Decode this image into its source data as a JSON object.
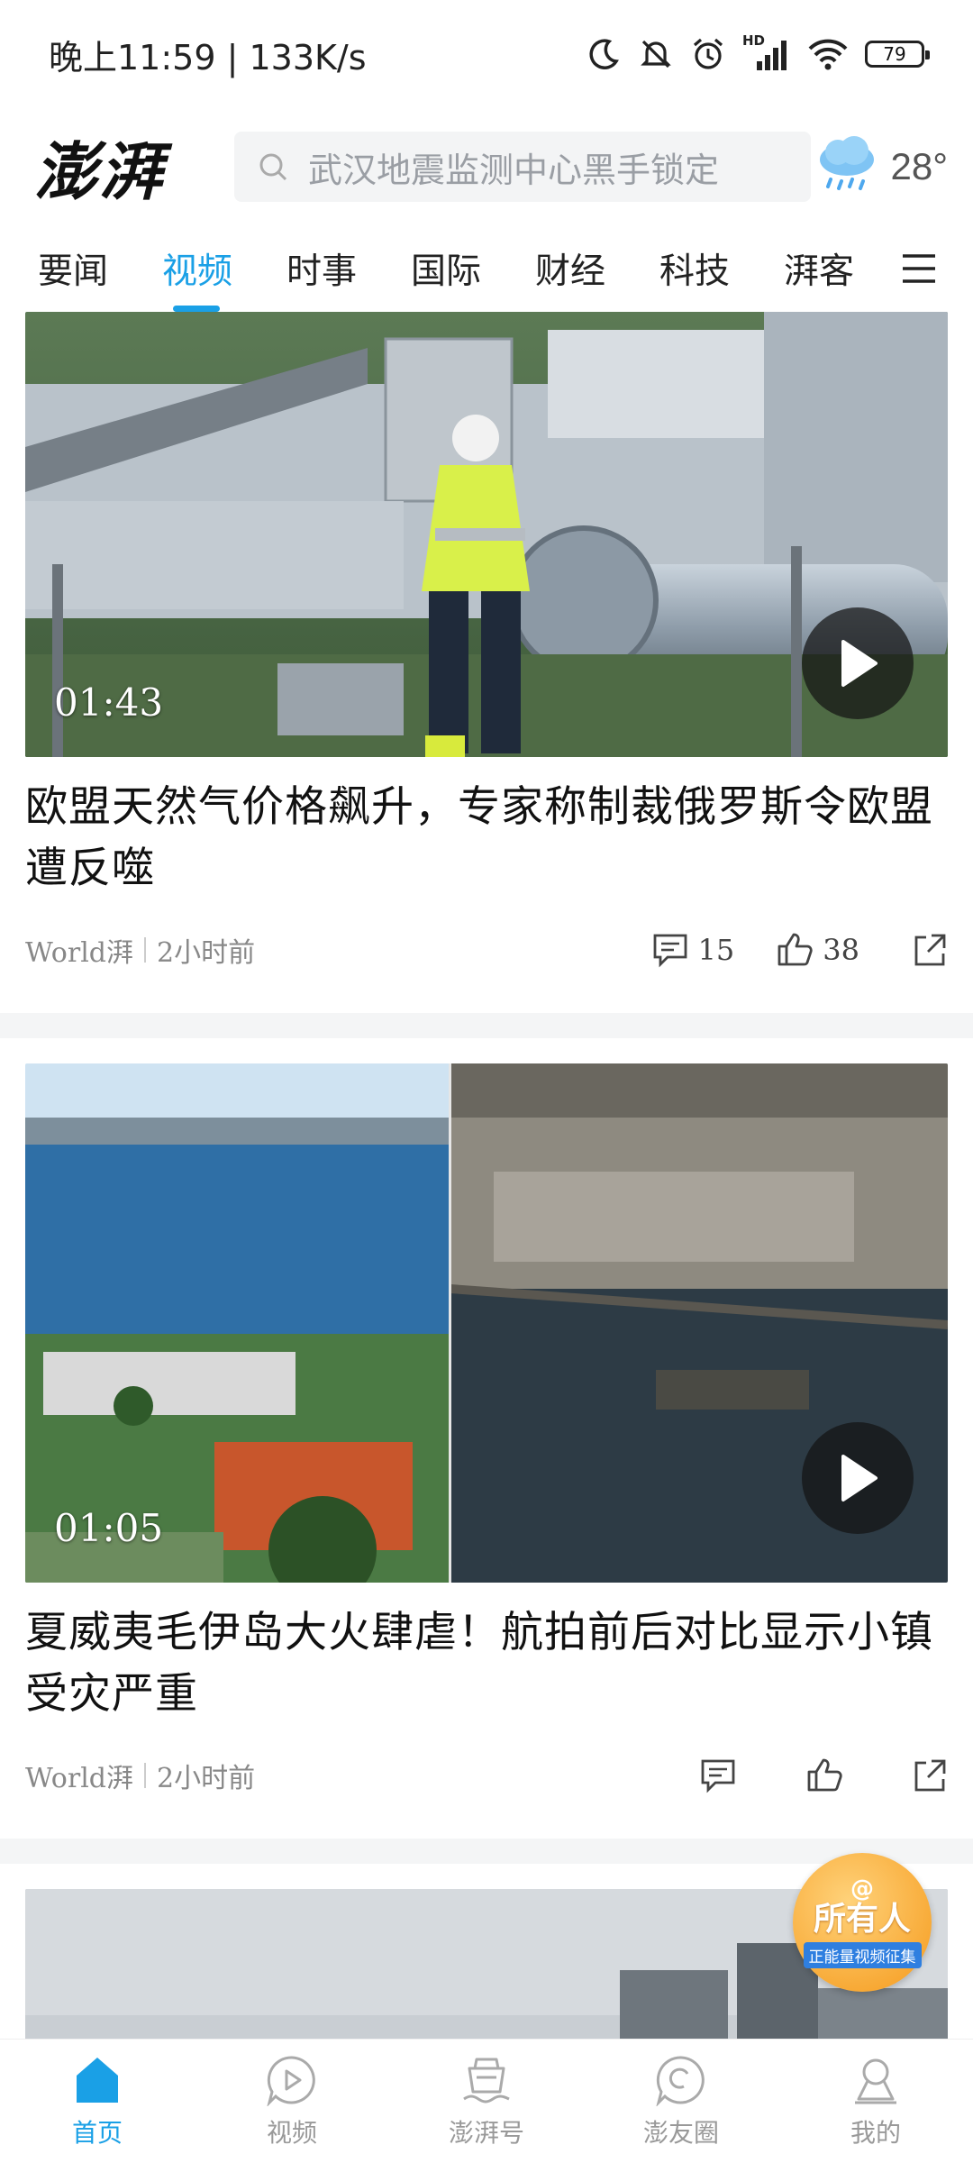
{
  "status_bar": {
    "time_speed": "晚上11:59 | 133K/s",
    "battery": "79",
    "network_label": "HD"
  },
  "header": {
    "logo": "澎湃",
    "search_placeholder": "武汉地震监测中心黑手锁定",
    "temperature": "28°",
    "weather_icon": "rain-cloud-icon"
  },
  "tabs": [
    {
      "label": "要闻",
      "active": false
    },
    {
      "label": "视频",
      "active": true
    },
    {
      "label": "时事",
      "active": false
    },
    {
      "label": "国际",
      "active": false
    },
    {
      "label": "财经",
      "active": false
    },
    {
      "label": "科技",
      "active": false
    },
    {
      "label": "湃客",
      "active": false
    }
  ],
  "feed": [
    {
      "duration": "01:43",
      "title": "欧盟天然气价格飙升，专家称制裁俄罗斯令欧盟遭反噬",
      "source": "World湃",
      "time": "2小时前",
      "comments": "15",
      "likes": "38"
    },
    {
      "duration": "01:05",
      "title": "夏威夷毛伊岛大火肆虐！航拍前后对比显示小镇受灾严重",
      "source": "World湃",
      "time": "2小时前",
      "comments": "",
      "likes": ""
    }
  ],
  "badge": {
    "at": "@",
    "main": "所有人",
    "sub": "正能量视频征集"
  },
  "bottom_nav": [
    {
      "label": "首页",
      "icon": "home-icon",
      "active": true
    },
    {
      "label": "视频",
      "icon": "video-play-icon",
      "active": false
    },
    {
      "label": "澎湃号",
      "icon": "ship-icon",
      "active": false
    },
    {
      "label": "澎友圈",
      "icon": "chat-bubble-icon",
      "active": false
    },
    {
      "label": "我的",
      "icon": "profile-icon",
      "active": false
    }
  ],
  "colors": {
    "accent": "#1aa0e6",
    "badge_orange": "#f59a1c"
  }
}
